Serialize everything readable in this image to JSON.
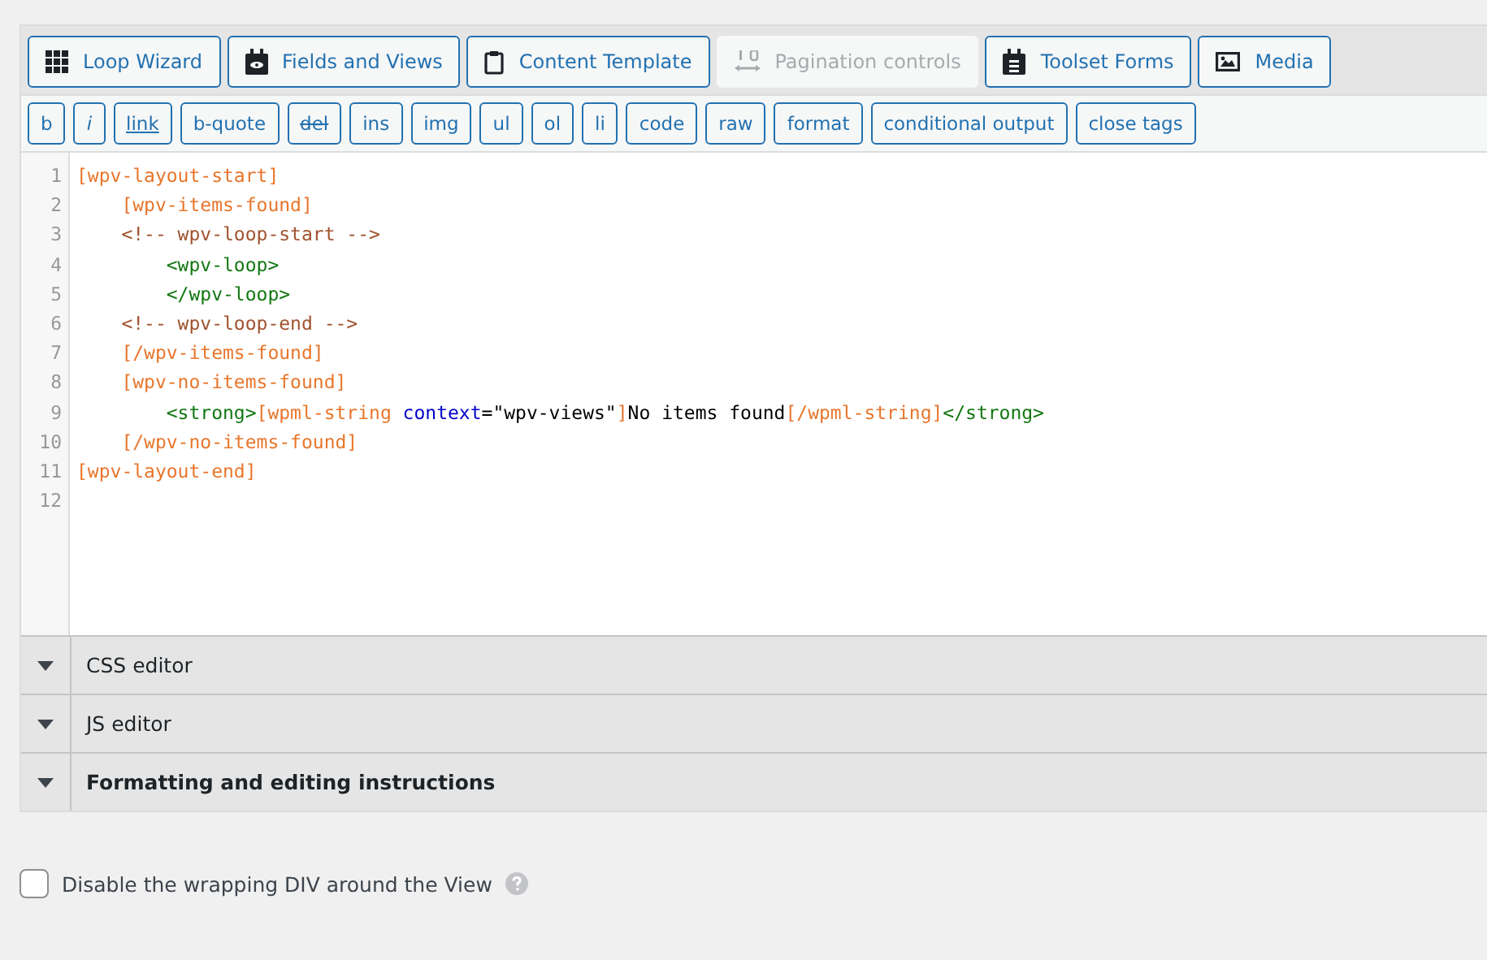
{
  "toolbar": [
    {
      "label": "Loop Wizard",
      "kind": "grid",
      "disabled": false
    },
    {
      "label": "Fields and Views",
      "kind": "card",
      "disabled": false
    },
    {
      "label": "Content Template",
      "kind": "clipboard",
      "disabled": false
    },
    {
      "label": "Pagination controls",
      "kind": "pagination",
      "disabled": true
    },
    {
      "label": "Toolset Forms",
      "kind": "form",
      "disabled": false
    },
    {
      "label": "Media",
      "kind": "image",
      "disabled": false
    }
  ],
  "quicktags": [
    {
      "label": "b",
      "kind": "plain"
    },
    {
      "label": "i",
      "kind": "italic"
    },
    {
      "label": "link",
      "kind": "underline"
    },
    {
      "label": "b-quote",
      "kind": "plain"
    },
    {
      "label": "del",
      "kind": "strike"
    },
    {
      "label": "ins",
      "kind": "plain"
    },
    {
      "label": "img",
      "kind": "plain"
    },
    {
      "label": "ul",
      "kind": "plain"
    },
    {
      "label": "ol",
      "kind": "plain"
    },
    {
      "label": "li",
      "kind": "plain"
    },
    {
      "label": "code",
      "kind": "plain"
    },
    {
      "label": "raw",
      "kind": "plain"
    },
    {
      "label": "format",
      "kind": "plain"
    },
    {
      "label": "conditional output",
      "kind": "plain"
    },
    {
      "label": "close tags",
      "kind": "plain"
    }
  ],
  "editor": {
    "lines": [
      {
        "number": "1",
        "tokens": [
          {
            "kind": "shortcode",
            "text": "[wpv-layout-start]"
          }
        ]
      },
      {
        "number": "2",
        "tokens": [
          {
            "kind": "shortcode",
            "text": "    [wpv-items-found]"
          }
        ]
      },
      {
        "number": "3",
        "tokens": [
          {
            "kind": "comment",
            "text": "    <!-- wpv-loop-start -->"
          }
        ]
      },
      {
        "number": "4",
        "tokens": [
          {
            "kind": "tag",
            "text": "        <wpv-loop>"
          }
        ]
      },
      {
        "number": "5",
        "tokens": [
          {
            "kind": "tag",
            "text": "        </wpv-loop>"
          }
        ]
      },
      {
        "number": "6",
        "tokens": [
          {
            "kind": "comment",
            "text": "    <!-- wpv-loop-end -->"
          }
        ]
      },
      {
        "number": "7",
        "tokens": [
          {
            "kind": "shortcode",
            "text": "    [/wpv-items-found]"
          }
        ]
      },
      {
        "number": "8",
        "tokens": [
          {
            "kind": "shortcode",
            "text": "    [wpv-no-items-found]"
          }
        ]
      },
      {
        "number": "9",
        "tokens": [
          {
            "kind": "tag",
            "text": "        <strong>"
          },
          {
            "kind": "shortcode",
            "text": "[wpml-string "
          },
          {
            "kind": "attribute",
            "text": "context"
          },
          {
            "kind": "plain",
            "text": "=\"wpv-views\""
          },
          {
            "kind": "shortcode",
            "text": "]"
          },
          {
            "kind": "plain",
            "text": "No items found"
          },
          {
            "kind": "shortcode",
            "text": "[/wpml-string]"
          },
          {
            "kind": "tag",
            "text": "</strong>"
          }
        ]
      },
      {
        "number": "10",
        "tokens": [
          {
            "kind": "shortcode",
            "text": "    [/wpv-no-items-found]"
          }
        ]
      },
      {
        "number": "11",
        "tokens": [
          {
            "kind": "shortcode",
            "text": "[wpv-layout-end]"
          }
        ]
      },
      {
        "number": "12"
      }
    ]
  },
  "sections": [
    {
      "title": "CSS editor",
      "bold": false,
      "expanded": false
    },
    {
      "title": "JS editor",
      "bold": false,
      "expanded": false
    },
    {
      "title": "Formatting and editing instructions",
      "bold": true,
      "expanded": false
    }
  ],
  "option": {
    "label": "Disable the wrapping DIV around the View",
    "checked": false
  }
}
